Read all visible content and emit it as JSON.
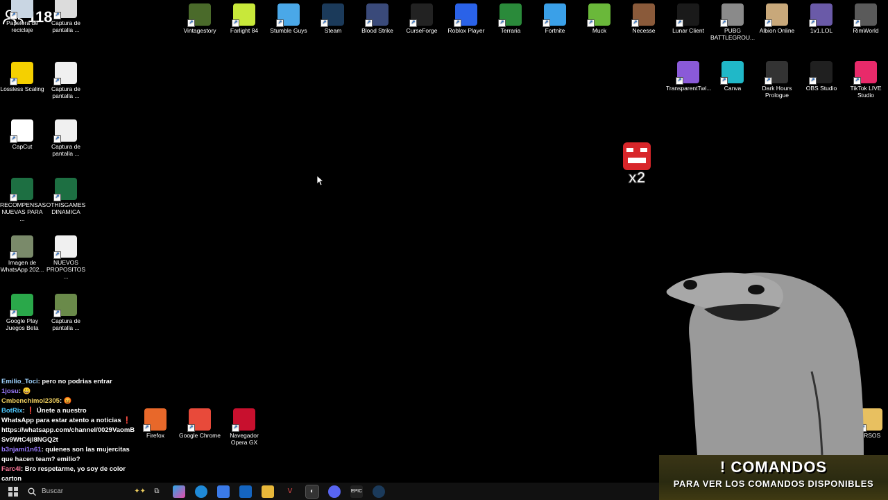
{
  "viewers": {
    "count": "118",
    "icon": "people-icon"
  },
  "left_icons": [
    {
      "label": "Papelera de reciclaje",
      "icon": "recycle-bin-icon",
      "color": "#c9d6e3"
    },
    {
      "label": "Captura de pantalla ...",
      "icon": "screenshot-icon",
      "color": "#dcdcdc"
    },
    {
      "label": "Lossless Scaling",
      "icon": "duck-icon",
      "color": "#f5d000"
    },
    {
      "label": "Captura de pantalla ...",
      "icon": "screenshot-icon",
      "color": "#f0f0f0"
    },
    {
      "label": "CapCut",
      "icon": "capcut-icon",
      "color": "#ffffff"
    },
    {
      "label": "Captura de pantalla ...",
      "icon": "screenshot-icon",
      "color": "#f0f0f0"
    },
    {
      "label": "RECOMPENSAS NUEVAS PARA ...",
      "icon": "excel-icon",
      "color": "#1d6f42"
    },
    {
      "label": "OTHISGAMES DINAMICA",
      "icon": "excel-icon",
      "color": "#1d6f42"
    },
    {
      "label": "Imagen de WhatsApp 202...",
      "icon": "image-icon",
      "color": "#7a8a6a"
    },
    {
      "label": "NUEVOS PROPOSITOS ...",
      "icon": "document-icon",
      "color": "#f0f0f0"
    },
    {
      "label": "Google Play Juegos Beta",
      "icon": "google-play-games-icon",
      "color": "#2aa84a"
    },
    {
      "label": "Captura de pantalla ...",
      "icon": "screenshot-icon",
      "color": "#6a8a4a"
    }
  ],
  "top_icons": [
    {
      "label": "Vintagestory",
      "icon": "tree-icon",
      "color": "#4a6a2a"
    },
    {
      "label": "Farlight 84",
      "icon": "farlight-icon",
      "color": "#c8e83a"
    },
    {
      "label": "Stumble Guys",
      "icon": "stumble-guys-icon",
      "color": "#4aa8e8"
    },
    {
      "label": "Steam",
      "icon": "steam-icon",
      "color": "#1b3a5a"
    },
    {
      "label": "Blood Strike",
      "icon": "blood-strike-icon",
      "color": "#3a4a7a"
    },
    {
      "label": "CurseForge",
      "icon": "curseforge-icon",
      "color": "#222222"
    },
    {
      "label": "Roblox Player",
      "icon": "roblox-icon",
      "color": "#2a62e8"
    },
    {
      "label": "Terraria",
      "icon": "terraria-icon",
      "color": "#2a8a3a"
    },
    {
      "label": "Fortnite",
      "icon": "fortnite-icon",
      "color": "#3aa0e8"
    },
    {
      "label": "Muck",
      "icon": "muck-icon",
      "color": "#6ab83a"
    },
    {
      "label": "Necesse",
      "icon": "necesse-icon",
      "color": "#8a5a3a"
    },
    {
      "label": "Lunar Client",
      "icon": "lunar-client-icon",
      "color": "#1a1a1a"
    },
    {
      "label": "PUBG BATTLEGROU...",
      "icon": "pubg-icon",
      "color": "#8a8a8a"
    },
    {
      "label": "Albion Online",
      "icon": "albion-icon",
      "color": "#c8a87a"
    },
    {
      "label": "1v1.LOL",
      "icon": "1v1lol-icon",
      "color": "#6a5aa8"
    },
    {
      "label": "RimWorld",
      "icon": "rimworld-icon",
      "color": "#5a5a5a"
    }
  ],
  "right_icons": [
    {
      "label": "TransparentTwi...",
      "icon": "chat-bubble-icon",
      "color": "#8a5ad8"
    },
    {
      "label": "Canva",
      "icon": "canva-icon",
      "color": "#20b8c8"
    },
    {
      "label": "Dark Hours Prologue",
      "icon": "dark-hours-icon",
      "color": "#333333"
    },
    {
      "label": "OBS Studio",
      "icon": "obs-icon",
      "color": "#202020"
    },
    {
      "label": "TikTok LIVE Studio",
      "icon": "tiktok-icon",
      "color": "#e82a6a"
    }
  ],
  "bottom_icons": [
    {
      "label": "Firefox",
      "icon": "firefox-icon",
      "color": "#e8682a"
    },
    {
      "label": "Google Chrome",
      "icon": "chrome-icon",
      "color": "#e84a3a"
    },
    {
      "label": "Navegador Opera GX",
      "icon": "opera-gx-icon",
      "color": "#c8102e"
    },
    {
      "label": "IRSOS",
      "icon": "folder-icon",
      "color": "#e8c060"
    }
  ],
  "chat": [
    {
      "user": "Emilio_Toci",
      "msg": ": pero no podrias entrar"
    },
    {
      "user": "1josu",
      "msg": ": 😀"
    },
    {
      "user": "Cmbenchimol2305",
      "msg": ": 😡"
    },
    {
      "user": "BotRix",
      "msg": ": ❗ Únete a nuestro"
    },
    {
      "user": "",
      "msg": "WhatsApp para estar atento a noticias ❗"
    },
    {
      "user": "",
      "msg": "https://whatsapp.com/channel/0029VaomB"
    },
    {
      "user": "",
      "msg": "Sv9WtC4jI8NGQ2t"
    },
    {
      "user": "b3njami1n61",
      "msg": ": quienes son las mujercitas"
    },
    {
      "user": "",
      "msg": "que hacen team? emilio?"
    },
    {
      "user": "Farc4l",
      "msg": ": Bro respetarme, yo soy de color"
    },
    {
      "user": "",
      "msg": "carton"
    }
  ],
  "overlay": {
    "multiplier": "x2"
  },
  "taskbar": {
    "search_placeholder": "Buscar"
  },
  "comandos": {
    "title": "! COMANDOS",
    "subtitle": "PARA VER LOS COMANDOS DISPONIBLES"
  }
}
